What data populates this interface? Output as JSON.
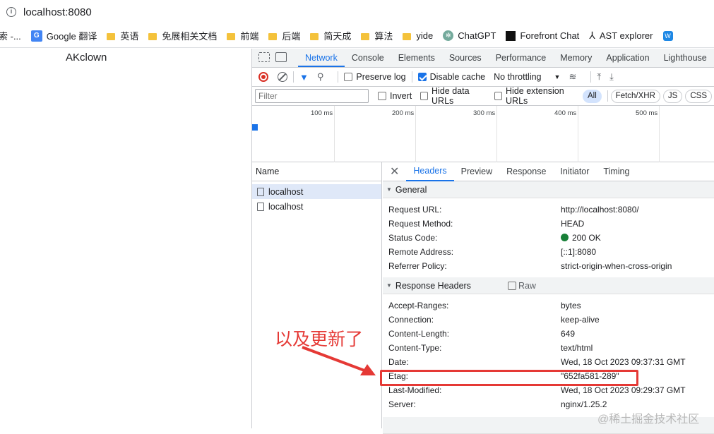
{
  "browser": {
    "url": "localhost:8080",
    "bookmarks": [
      {
        "label": "索 -...",
        "icon": "text"
      },
      {
        "label": "Google 翻译",
        "icon": "google-translate-icon"
      },
      {
        "label": "英语",
        "icon": "folder-icon"
      },
      {
        "label": "免展相关文档",
        "icon": "folder-icon"
      },
      {
        "label": "前端",
        "icon": "folder-icon"
      },
      {
        "label": "后端",
        "icon": "folder-icon"
      },
      {
        "label": "简天成",
        "icon": "folder-icon"
      },
      {
        "label": "算法",
        "icon": "folder-icon"
      },
      {
        "label": "yide",
        "icon": "folder-icon"
      },
      {
        "label": "ChatGPT",
        "icon": "chatgpt-icon"
      },
      {
        "label": "Forefront Chat",
        "icon": "forefront-icon"
      },
      {
        "label": "AST explorer",
        "icon": "ast-icon"
      }
    ]
  },
  "page": {
    "text": "AKclown"
  },
  "devtools": {
    "tabs": [
      "Network",
      "Console",
      "Elements",
      "Sources",
      "Performance",
      "Memory",
      "Application",
      "Lighthouse"
    ],
    "active_tab": "Network",
    "toolbar": {
      "preserve_log": "Preserve log",
      "disable_cache": "Disable cache",
      "throttling": "No throttling"
    },
    "filter": {
      "placeholder": "Filter",
      "invert": "Invert",
      "hide_data_urls": "Hide data URLs",
      "hide_extension_urls": "Hide extension URLs",
      "types": [
        "All",
        "Fetch/XHR",
        "JS",
        "CSS"
      ]
    },
    "timeline": {
      "labels": [
        "100 ms",
        "200 ms",
        "300 ms",
        "400 ms",
        "500 ms"
      ]
    },
    "name_column": {
      "header": "Name",
      "items": [
        "localhost",
        "localhost"
      ]
    },
    "detail_tabs": [
      "Headers",
      "Preview",
      "Response",
      "Initiator",
      "Timing"
    ],
    "general": {
      "title": "General",
      "rows": [
        {
          "k": "Request URL:",
          "v": "http://localhost:8080/"
        },
        {
          "k": "Request Method:",
          "v": "HEAD"
        },
        {
          "k": "Status Code:",
          "v": "200 OK"
        },
        {
          "k": "Remote Address:",
          "v": "[::1]:8080"
        },
        {
          "k": "Referrer Policy:",
          "v": "strict-origin-when-cross-origin"
        }
      ]
    },
    "response_headers": {
      "title": "Response Headers",
      "raw": "Raw",
      "rows": [
        {
          "k": "Accept-Ranges:",
          "v": "bytes"
        },
        {
          "k": "Connection:",
          "v": "keep-alive"
        },
        {
          "k": "Content-Length:",
          "v": "649"
        },
        {
          "k": "Content-Type:",
          "v": "text/html"
        },
        {
          "k": "Date:",
          "v": "Wed, 18 Oct 2023 09:37:31 GMT"
        },
        {
          "k": "Etag:",
          "v": "\"652fa581-289\""
        },
        {
          "k": "Last-Modified:",
          "v": "Wed, 18 Oct 2023 09:29:37 GMT"
        },
        {
          "k": "Server:",
          "v": "nginx/1.25.2"
        }
      ]
    }
  },
  "annotation": {
    "text": "以及更新了",
    "color": "#e53935"
  },
  "watermark": "@稀土掘金技术社区"
}
